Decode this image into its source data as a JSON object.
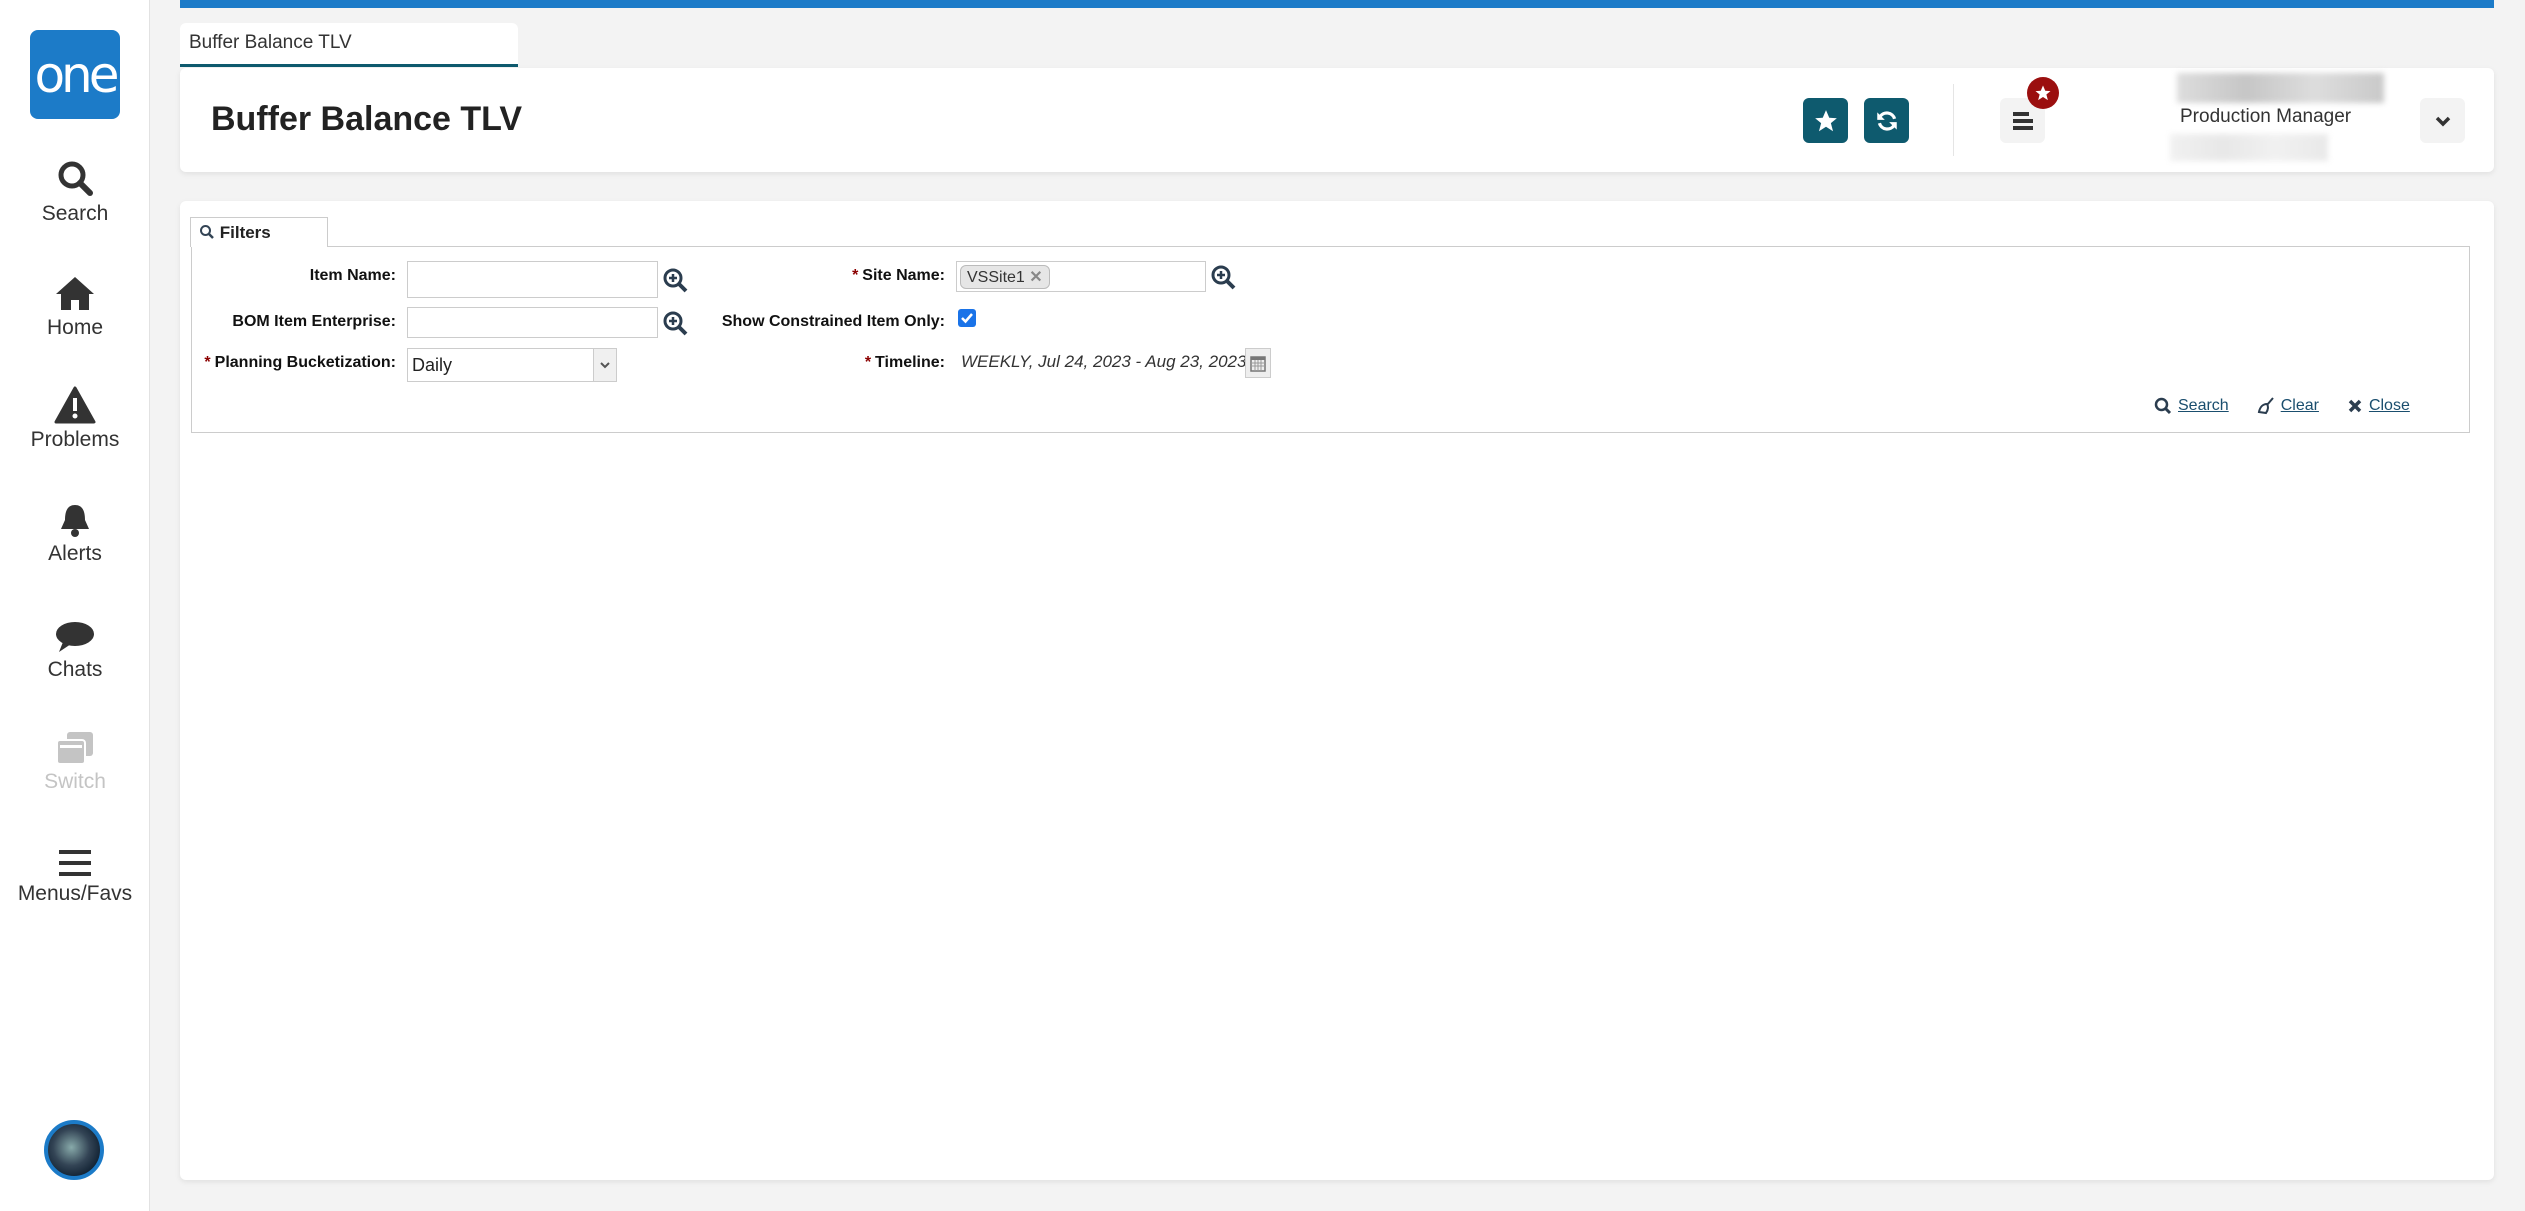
{
  "sidebar": {
    "logo": "one",
    "items": [
      {
        "label": "Search",
        "icon": "search-icon"
      },
      {
        "label": "Home",
        "icon": "home-icon"
      },
      {
        "label": "Problems",
        "icon": "warning-icon"
      },
      {
        "label": "Alerts",
        "icon": "bell-icon"
      },
      {
        "label": "Chats",
        "icon": "chat-icon"
      },
      {
        "label": "Switch",
        "icon": "switch-icon",
        "disabled": true
      },
      {
        "label": "Menus/Favs",
        "icon": "menu-icon"
      }
    ]
  },
  "tab": {
    "label": "Buffer Balance TLV"
  },
  "header": {
    "title": "Buffer Balance TLV",
    "role": "Production Manager"
  },
  "filters": {
    "tab_label": "Filters",
    "item_name": {
      "label": "Item Name:",
      "value": ""
    },
    "bom_item_enterprise": {
      "label": "BOM Item Enterprise:",
      "value": ""
    },
    "planning_bucketization": {
      "label": "Planning Bucketization:",
      "value": "Daily",
      "required": true
    },
    "site_name": {
      "label": "Site Name:",
      "chip": "VSSite1",
      "required": true
    },
    "show_constrained": {
      "label": "Show Constrained Item Only:",
      "checked": true
    },
    "timeline": {
      "label": "Timeline:",
      "value": "WEEKLY, Jul 24, 2023 - Aug 23, 2023",
      "required": true
    },
    "required_marker": "*",
    "actions": {
      "search": "Search",
      "clear": "Clear",
      "close": "Close"
    }
  },
  "colors": {
    "brand": "#1c7bc8",
    "teal": "#0e5a6e",
    "badge": "#9b0f0f"
  }
}
